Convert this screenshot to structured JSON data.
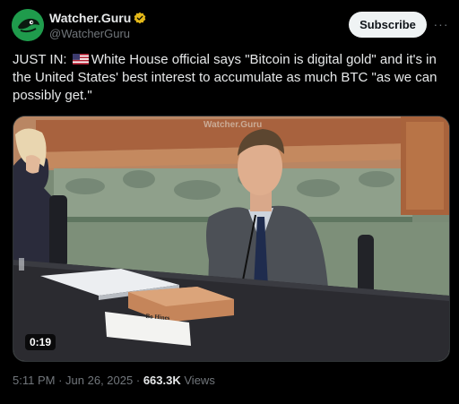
{
  "author": {
    "display_name": "Watcher.Guru",
    "handle": "@WatcherGuru",
    "verified_badge_color": "#e2b719",
    "avatar_color": "#1f9b4c"
  },
  "actions": {
    "subscribe_label": "Subscribe",
    "more_label": "···"
  },
  "tweet": {
    "prefix": "JUST IN:",
    "flag_icon": "us-flag-icon",
    "text": "White House official says \"Bitcoin is digital gold\" and it's in the United States' best interest to accumulate as much BTC \"as we can possibly get.\""
  },
  "media": {
    "watermark": "Watcher.Guru",
    "nameplate": "Bo Hines",
    "duration": "0:19"
  },
  "meta": {
    "time": "5:11 PM",
    "separator": "·",
    "date": "Jun 26, 2025",
    "views_count": "663.3K",
    "views_label": "Views"
  },
  "colors": {
    "background": "#000000",
    "text_primary": "#e7e9ea",
    "text_secondary": "#71767b",
    "button_bg": "#eff3f4"
  }
}
